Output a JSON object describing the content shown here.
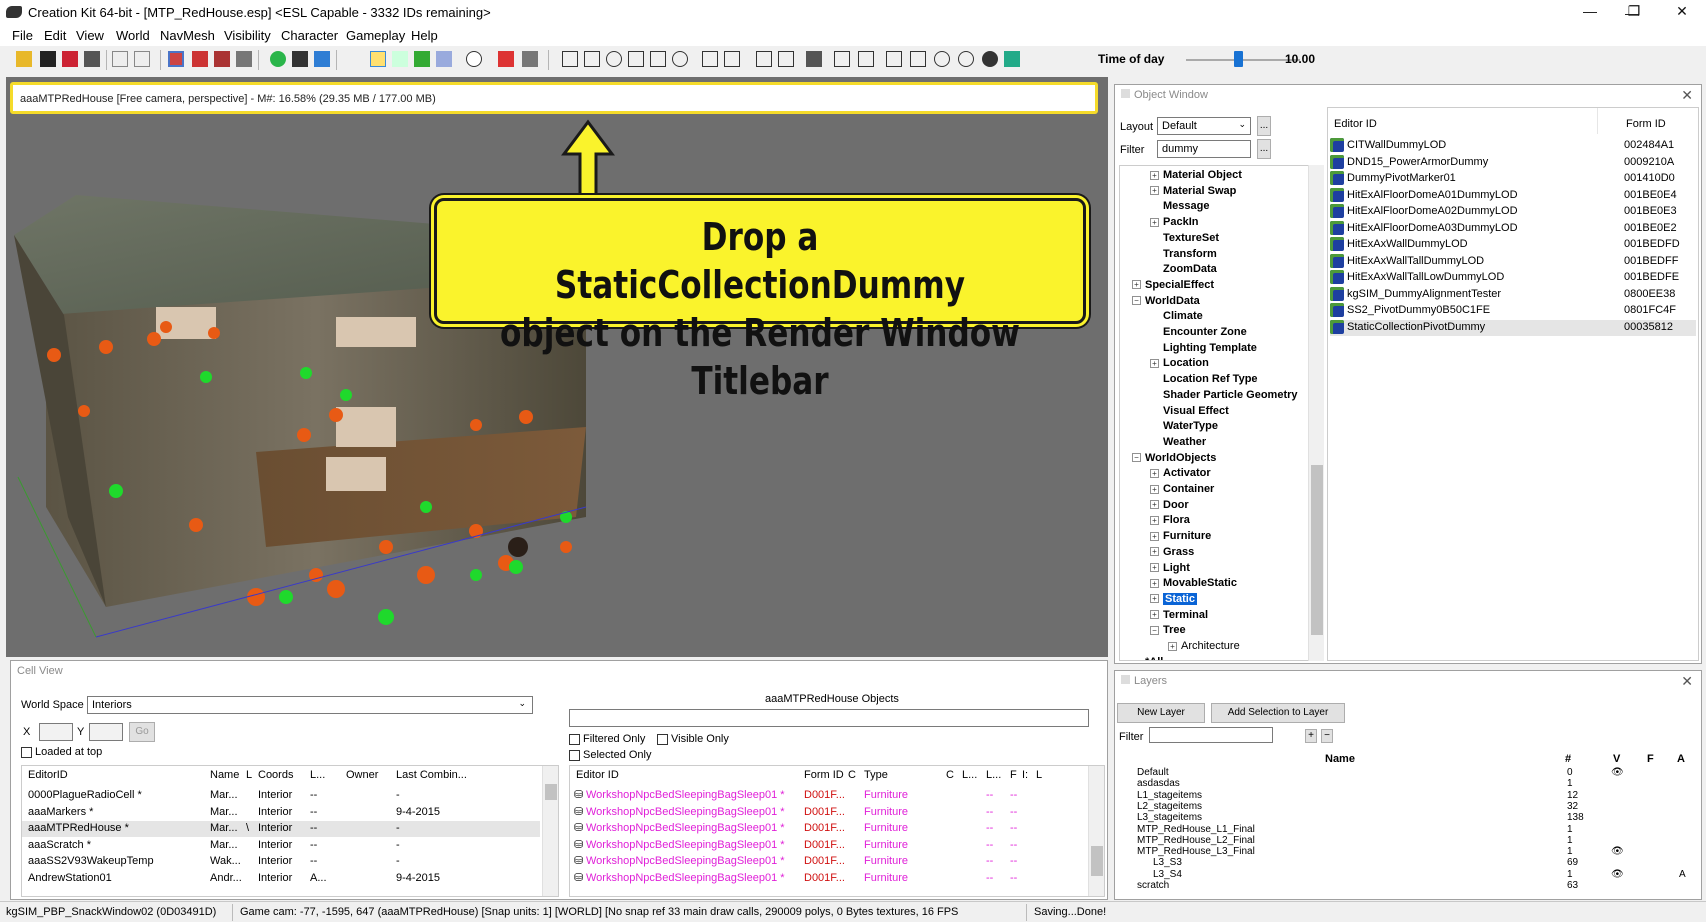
{
  "window": {
    "title": "Creation Kit 64-bit - [MTP_RedHouse.esp] <ESL Capable - 3332 IDs remaining>",
    "min": "—",
    "max": "❐",
    "close": "✕"
  },
  "menu": [
    "File",
    "Edit",
    "View",
    "World",
    "NavMesh",
    "Visibility",
    "Character",
    "Gameplay",
    "Help"
  ],
  "toolbar": {
    "time_label": "Time of day",
    "time_value": "10.00",
    "time_fraction": 0.42
  },
  "render": {
    "title": "aaaMTPRedHouse [Free camera, perspective] - M#: 16.58% (29.35 MB / 177.00 MB)",
    "callout_line1": "Drop a StaticCollectionDummy",
    "callout_line2": "object on the Render Window Titlebar"
  },
  "object_window": {
    "title": "Object Window",
    "layout_label": "Layout",
    "layout_value": "Default",
    "filter_label": "Filter",
    "filter_value": "dummy",
    "more": "...",
    "tree": [
      {
        "label": "Material Object",
        "exp": "+",
        "indent": 1
      },
      {
        "label": "Material Swap",
        "exp": "+",
        "indent": 1
      },
      {
        "label": "Message",
        "exp": "",
        "indent": 1
      },
      {
        "label": "PackIn",
        "exp": "+",
        "indent": 1
      },
      {
        "label": "TextureSet",
        "exp": "",
        "indent": 1
      },
      {
        "label": "Transform",
        "exp": "",
        "indent": 1
      },
      {
        "label": "ZoomData",
        "exp": "",
        "indent": 1
      },
      {
        "label": "SpecialEffect",
        "exp": "+",
        "indent": 0
      },
      {
        "label": "WorldData",
        "exp": "−",
        "indent": 0
      },
      {
        "label": "Climate",
        "exp": "",
        "indent": 1
      },
      {
        "label": "Encounter Zone",
        "exp": "",
        "indent": 1
      },
      {
        "label": "Lighting Template",
        "exp": "",
        "indent": 1
      },
      {
        "label": "Location",
        "exp": "+",
        "indent": 1
      },
      {
        "label": "Location Ref Type",
        "exp": "",
        "indent": 1
      },
      {
        "label": "Shader Particle Geometry",
        "exp": "",
        "indent": 1
      },
      {
        "label": "Visual Effect",
        "exp": "",
        "indent": 1
      },
      {
        "label": "WaterType",
        "exp": "",
        "indent": 1
      },
      {
        "label": "Weather",
        "exp": "",
        "indent": 1
      },
      {
        "label": "WorldObjects",
        "exp": "−",
        "indent": 0
      },
      {
        "label": "Activator",
        "exp": "+",
        "indent": 1
      },
      {
        "label": "Container",
        "exp": "+",
        "indent": 1
      },
      {
        "label": "Door",
        "exp": "+",
        "indent": 1
      },
      {
        "label": "Flora",
        "exp": "+",
        "indent": 1
      },
      {
        "label": "Furniture",
        "exp": "+",
        "indent": 1
      },
      {
        "label": "Grass",
        "exp": "+",
        "indent": 1
      },
      {
        "label": "Light",
        "exp": "+",
        "indent": 1
      },
      {
        "label": "MovableStatic",
        "exp": "+",
        "indent": 1
      },
      {
        "label": "Static",
        "exp": "+",
        "indent": 1,
        "selected": true
      },
      {
        "label": "Terminal",
        "exp": "+",
        "indent": 1
      },
      {
        "label": "Tree",
        "exp": "−",
        "indent": 1
      },
      {
        "label": "Architecture",
        "exp": "+",
        "indent": 2
      },
      {
        "label": "*All",
        "exp": "",
        "indent": 0
      }
    ],
    "columns": [
      "Editor ID",
      "Form ID"
    ],
    "rows": [
      {
        "id": "CITWallDummyLOD",
        "form": "002484A1"
      },
      {
        "id": "DND15_PowerArmorDummy",
        "form": "0009210A"
      },
      {
        "id": "DummyPivotMarker01",
        "form": "001410D0"
      },
      {
        "id": "HitExAlFloorDomeA01DummyLOD",
        "form": "001BE0E4"
      },
      {
        "id": "HitExAlFloorDomeA02DummyLOD",
        "form": "001BE0E3"
      },
      {
        "id": "HitExAlFloorDomeA03DummyLOD",
        "form": "001BE0E2"
      },
      {
        "id": "HitExAxWallDummyLOD",
        "form": "001BEDFD"
      },
      {
        "id": "HitExAxWallTallDummyLOD",
        "form": "001BEDFF"
      },
      {
        "id": "HitExAxWallTallLowDummyLOD",
        "form": "001BEDFE"
      },
      {
        "id": "kgSIM_DummyAlignmentTester",
        "form": "0800EE38"
      },
      {
        "id": "SS2_PivotDummy0B50C1FE",
        "form": "0801FC4F"
      },
      {
        "id": "StaticCollectionPivotDummy",
        "form": "00035812"
      }
    ]
  },
  "cell_view": {
    "title": "Cell View",
    "world_space_label": "World Space",
    "world_space_value": "Interiors",
    "x_label": "X",
    "y_label": "Y",
    "go": "Go",
    "loaded_at_top": "Loaded at top",
    "columns": [
      "EditorID",
      "Name",
      "L",
      "Coords",
      "L...",
      "Owner",
      "Last Combin..."
    ],
    "rows": [
      {
        "id": "0000PlagueRadioCell *",
        "name": "Mar...",
        "l": "",
        "coords": "Interior",
        "l2": "--",
        "owner": "",
        "last": "-"
      },
      {
        "id": "aaaMarkers *",
        "name": "Mar...",
        "l": "",
        "coords": "Interior",
        "l2": "--",
        "owner": "",
        "last": "9-4-2015"
      },
      {
        "id": "aaaMTPRedHouse *",
        "name": "Mar...",
        "l": "\\",
        "coords": "Interior",
        "l2": "--",
        "owner": "",
        "last": "-"
      },
      {
        "id": "aaaScratch *",
        "name": "Mar...",
        "l": "",
        "coords": "Interior",
        "l2": "--",
        "owner": "",
        "last": "-"
      },
      {
        "id": "aaaSS2V93WakeupTemp",
        "name": "Wak...",
        "l": "",
        "coords": "Interior",
        "l2": "--",
        "owner": "",
        "last": "-"
      },
      {
        "id": "AndrewStation01",
        "name": "Andr...",
        "l": "",
        "coords": "Interior",
        "l2": "A...",
        "owner": "",
        "last": "9-4-2015"
      }
    ],
    "objects_title": "aaaMTPRedHouse Objects",
    "filtered_only": "Filtered Only",
    "visible_only": "Visible Only",
    "selected_only": "Selected Only",
    "obj_columns": [
      "Editor ID",
      "Form ID",
      "C",
      "Type",
      "C",
      "L...",
      "L...",
      "F",
      "I:",
      "L"
    ],
    "obj_rows": [
      {
        "id": "WorkshopNpcBedSleepingBagSleep01 *",
        "form": "D001F...",
        "type": "Furniture",
        "a": "--",
        "b": "--"
      },
      {
        "id": "WorkshopNpcBedSleepingBagSleep01 *",
        "form": "D001F...",
        "type": "Furniture",
        "a": "--",
        "b": "--"
      },
      {
        "id": "WorkshopNpcBedSleepingBagSleep01 *",
        "form": "D001F...",
        "type": "Furniture",
        "a": "--",
        "b": "--"
      },
      {
        "id": "WorkshopNpcBedSleepingBagSleep01 *",
        "form": "D001F...",
        "type": "Furniture",
        "a": "--",
        "b": "--"
      },
      {
        "id": "WorkshopNpcBedSleepingBagSleep01 *",
        "form": "D001F...",
        "type": "Furniture",
        "a": "--",
        "b": "--"
      },
      {
        "id": "WorkshopNpcBedSleepingBagSleep01 *",
        "form": "D001F...",
        "type": "Furniture",
        "a": "--",
        "b": "--"
      }
    ]
  },
  "layers": {
    "title": "Layers",
    "new_layer": "New Layer",
    "add_selection": "Add Selection to Layer",
    "filter_label": "Filter",
    "plus": "+",
    "minus": "−",
    "columns": [
      "Name",
      "#",
      "V",
      "F",
      "A"
    ],
    "rows": [
      {
        "name": "Default",
        "count": "0",
        "v": "👁",
        "a": "",
        "indent": 0
      },
      {
        "name": "asdasdas",
        "count": "1",
        "v": "",
        "a": "",
        "indent": 0
      },
      {
        "name": "L1_stageitems",
        "count": "12",
        "v": "",
        "a": "",
        "indent": 0
      },
      {
        "name": "L2_stageitems",
        "count": "32",
        "v": "",
        "a": "",
        "indent": 0
      },
      {
        "name": "L3_stageitems",
        "count": "138",
        "v": "",
        "a": "",
        "indent": 0
      },
      {
        "name": "MTP_RedHouse_L1_Final",
        "count": "1",
        "v": "",
        "a": "",
        "indent": 0
      },
      {
        "name": "MTP_RedHouse_L2_Final",
        "count": "1",
        "v": "",
        "a": "",
        "indent": 0
      },
      {
        "name": "MTP_RedHouse_L3_Final",
        "count": "1",
        "v": "👁",
        "a": "",
        "indent": 0
      },
      {
        "name": "L3_S3",
        "count": "69",
        "v": "",
        "a": "",
        "indent": 1
      },
      {
        "name": "L3_S4",
        "count": "1",
        "v": "👁",
        "a": "A",
        "indent": 1
      },
      {
        "name": "scratch",
        "count": "63",
        "v": "",
        "a": "",
        "indent": 0
      }
    ]
  },
  "status": {
    "s1": "kgSIM_PBP_SnackWindow02 (0D03491D)",
    "s2": "Game cam: -77, -1595, 647 (aaaMTPRedHouse) [Snap units: 1] [WORLD] [No snap ref 33 main draw calls, 290009 polys, 0 Bytes textures, 16 FPS",
    "s3": "Saving...Done!"
  }
}
